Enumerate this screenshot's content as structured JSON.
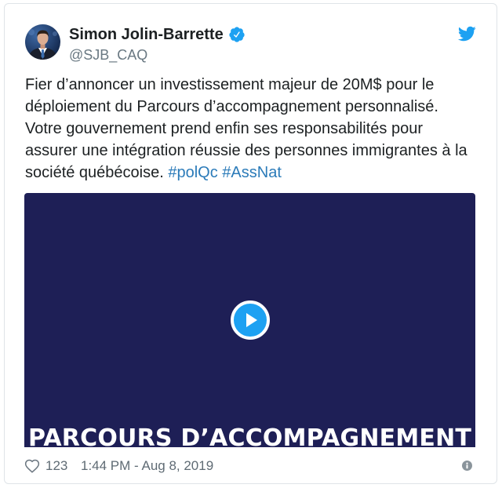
{
  "author": {
    "name": "Simon Jolin-Barrette",
    "handle": "@SJB_CAQ",
    "verified": true,
    "avatar_icon": "avatar-photo",
    "verified_icon": "verified-badge-icon"
  },
  "brand": {
    "icon": "twitter-bird-icon",
    "color": "#1da1f2"
  },
  "tweet": {
    "lines": [
      "Fier d’annoncer un investissement majeur de 20M$ pour le",
      "déploiement du Parcours d’accompagnement personnalisé.",
      "Votre gouvernement prend enfin ses responsabilités pour",
      "assurer une intégration réussie des personnes immigrantes à la",
      "société québécoise."
    ],
    "hashtags": [
      "#polQc",
      "#AssNat"
    ]
  },
  "media": {
    "type": "video",
    "overlay_text": "PARCOURS D’ACCOMPAGNEMENT",
    "background": "#1e1f56",
    "play_icon": "play-icon"
  },
  "footer": {
    "like_icon": "heart-icon",
    "like_count": "123",
    "timestamp": "1:44 PM - Aug 8, 2019",
    "info_icon": "info-icon"
  },
  "colors": {
    "text": "#1c2022",
    "secondary": "#697882",
    "link": "#2b7bb9",
    "accent": "#1da1f2"
  }
}
